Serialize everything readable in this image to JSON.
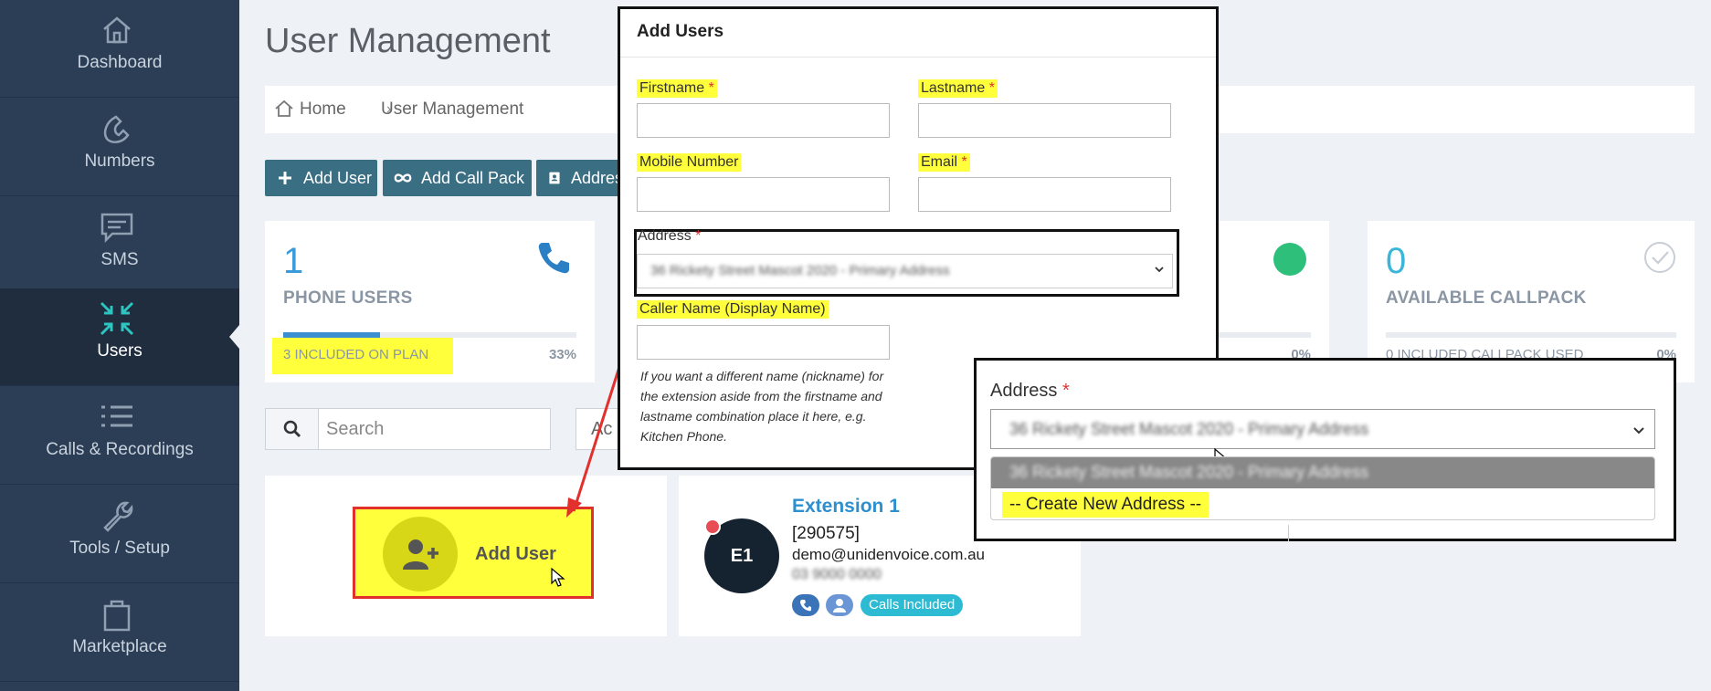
{
  "sidebar": {
    "items": [
      {
        "label": "Dashboard",
        "icon": "home-icon"
      },
      {
        "label": "Numbers",
        "icon": "phone-handset-icon"
      },
      {
        "label": "SMS",
        "icon": "chat-bubble-icon"
      },
      {
        "label": "Users",
        "icon": "compress-arrows-icon",
        "active": true
      },
      {
        "label": "Calls & Recordings",
        "icon": "list-icon"
      },
      {
        "label": "Tools / Setup",
        "icon": "wrench-icon"
      },
      {
        "label": "Marketplace",
        "icon": "shopping-bag-icon"
      }
    ]
  },
  "header": {
    "title": "User Management",
    "breadcrumb": [
      "Home",
      "User Management"
    ]
  },
  "toolbar": {
    "add_user": "Add User",
    "add_call_pack": "Add Call Pack",
    "address": "Addres"
  },
  "stats": {
    "phone_users": {
      "value": "1",
      "label": "PHONE USERS",
      "included": "3 INCLUDED ON PLAN",
      "percent": "33%",
      "fill": 0.33
    },
    "middle": {
      "percent": "0%"
    },
    "callpack": {
      "value": "0",
      "label": "AVAILABLE CALLPACK",
      "included": "0 INCLUDED CALLPACK USED",
      "percent": "0%"
    }
  },
  "search": {
    "placeholder": "Search",
    "action_partial": "Ac"
  },
  "add_user_card": {
    "label": "Add User"
  },
  "extension": {
    "avatar": "E1",
    "title": "Extension 1",
    "number": "[290575]",
    "email": "demo@unidenvoice.com.au",
    "phone": "03 9000 0000",
    "badge": "Calls Included"
  },
  "modal": {
    "title": "Add Users",
    "firstname": "Firstname",
    "lastname": "Lastname",
    "mobile": "Mobile Number",
    "email": "Email",
    "address": "Address",
    "address_value": "36 Rickety Street Mascot 2020 - Primary Address",
    "caller_name": "Caller Name (Display Name)",
    "help": "If you want a different name (nickname) for the extension aside from the firstname and lastname combination place it here, e.g. Kitchen Phone.",
    "required_mark": "*"
  },
  "zoom": {
    "label": "Address",
    "selected": "36 Rickety Street Mascot 2020 - Primary Address",
    "options": [
      "36 Rickety Street Mascot 2020 - Primary Address",
      "-- Create New Address --"
    ]
  },
  "colors": {
    "sidebar_bg": "#2c3e55",
    "accent_teal": "#3a6e82",
    "highlight": "#ffff3c",
    "annotation_red": "#e2302c",
    "link_blue": "#2e8fcf"
  }
}
